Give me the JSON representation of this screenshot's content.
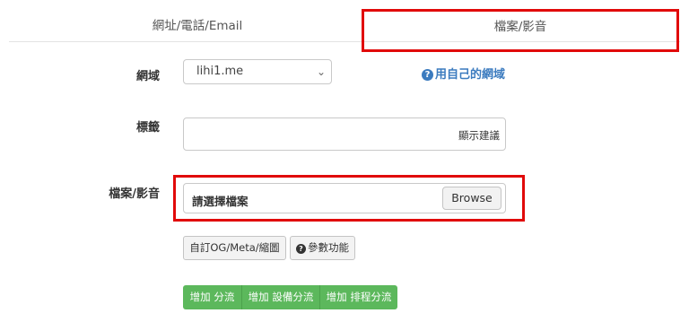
{
  "tabs": [
    {
      "label": "網址/電話/Email"
    },
    {
      "label": "檔案/影音"
    }
  ],
  "form": {
    "domain_label": "網域",
    "domain_value": "lihi1.me",
    "own_domain_link": "用自己的網域",
    "tag_label": "標籤",
    "tag_hint": "顯示建議",
    "file_label": "檔案/影音",
    "file_placeholder": "請選擇檔案",
    "browse_label": "Browse"
  },
  "buttons": {
    "og_meta": "自訂OG/Meta/縮圖",
    "params": "參數功能",
    "add_split": "增加 分流",
    "add_device_split": "增加 設備分流",
    "add_schedule_split": "增加 排程分流"
  },
  "icons": {
    "question": "?",
    "chevron": "⌄"
  },
  "colors": {
    "highlight": "#e10a0a",
    "link": "#3b7bbf",
    "success": "#5cb85c"
  }
}
